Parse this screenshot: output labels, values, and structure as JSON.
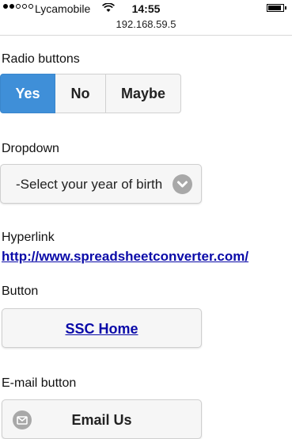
{
  "status_bar": {
    "carrier": "Lycamobile",
    "time": "14:55",
    "url": "192.168.59.5",
    "signal_bars_filled": 2,
    "signal_bars_total": 5,
    "battery_level": 0.9
  },
  "radio_section": {
    "label": "Radio buttons",
    "options": [
      "Yes",
      "No",
      "Maybe"
    ],
    "selected": "Yes",
    "accent_color": "#3f8fd8"
  },
  "dropdown_section": {
    "label": "Dropdown",
    "selected_value": "-Select your year of birth",
    "icon": "chevron-down-icon"
  },
  "hyperlink_section": {
    "label": "Hyperlink",
    "link_text": "http://www.spreadsheetconverter.com/"
  },
  "button_section": {
    "label": "Button",
    "button_text": "SSC Home"
  },
  "email_section": {
    "label": "E-mail button",
    "button_text": "Email Us",
    "icon": "mail-icon"
  }
}
